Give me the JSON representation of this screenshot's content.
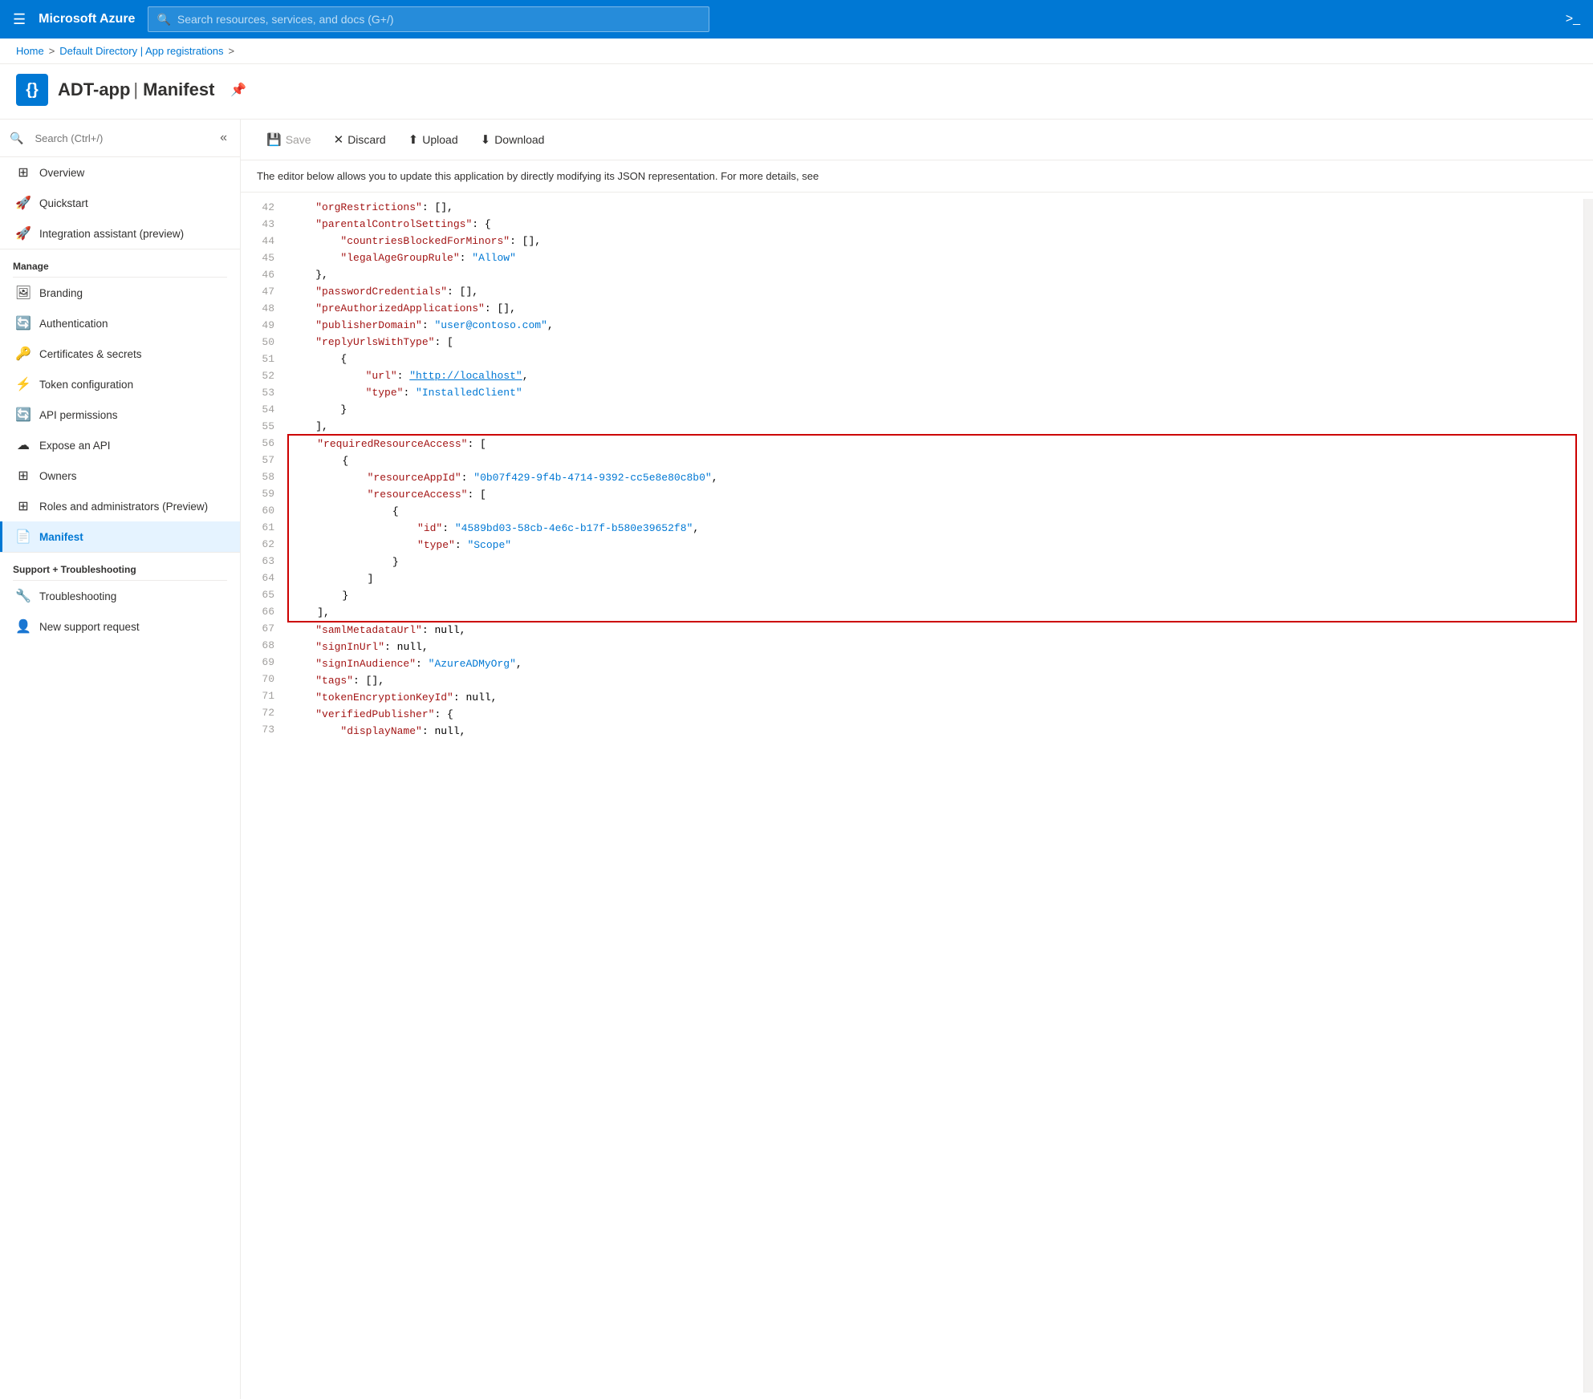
{
  "topNav": {
    "brand": "Microsoft Azure",
    "searchPlaceholder": "Search resources, services, and docs (G+/)",
    "hamburgerIcon": "☰",
    "cloudShellIcon": ">_"
  },
  "breadcrumb": {
    "home": "Home",
    "separator1": ">",
    "directoryLink": "Default Directory | App registrations",
    "separator2": ">"
  },
  "pageHeader": {
    "iconSymbol": "{}",
    "appName": "ADT-app",
    "separator": "|",
    "pageName": "Manifest",
    "pinIcon": "📌"
  },
  "toolbar": {
    "saveLabel": "Save",
    "discardLabel": "Discard",
    "uploadLabel": "Upload",
    "downloadLabel": "Download"
  },
  "description": "The editor below allows you to update this application by directly modifying its JSON representation. For more details, see",
  "sidebar": {
    "searchPlaceholder": "Search (Ctrl+/)",
    "items": [
      {
        "id": "overview",
        "label": "Overview",
        "icon": "⊞",
        "active": false
      },
      {
        "id": "quickstart",
        "label": "Quickstart",
        "icon": "🚀",
        "active": false
      },
      {
        "id": "integration",
        "label": "Integration assistant (preview)",
        "icon": "🚀",
        "active": false
      }
    ],
    "manageSection": "Manage",
    "manageItems": [
      {
        "id": "branding",
        "label": "Branding",
        "icon": "🖼",
        "active": false
      },
      {
        "id": "authentication",
        "label": "Authentication",
        "icon": "🔄",
        "active": false
      },
      {
        "id": "certificates",
        "label": "Certificates & secrets",
        "icon": "🔑",
        "active": false
      },
      {
        "id": "token",
        "label": "Token configuration",
        "icon": "⚡",
        "active": false
      },
      {
        "id": "api-permissions",
        "label": "API permissions",
        "icon": "🔄",
        "active": false
      },
      {
        "id": "expose-api",
        "label": "Expose an API",
        "icon": "☁",
        "active": false
      },
      {
        "id": "owners",
        "label": "Owners",
        "icon": "⊞",
        "active": false
      },
      {
        "id": "roles",
        "label": "Roles and administrators (Preview)",
        "icon": "⊞",
        "active": false
      },
      {
        "id": "manifest",
        "label": "Manifest",
        "icon": "📄",
        "active": true
      }
    ],
    "supportSection": "Support + Troubleshooting",
    "supportItems": [
      {
        "id": "troubleshooting",
        "label": "Troubleshooting",
        "icon": "🔧",
        "active": false
      },
      {
        "id": "support",
        "label": "New support request",
        "icon": "👤",
        "active": false
      }
    ]
  },
  "codeLines": [
    {
      "num": 42,
      "content": "    \"orgRestrictions\": [],",
      "highlight": false
    },
    {
      "num": 43,
      "content": "    \"parentalControlSettings\": {",
      "highlight": false
    },
    {
      "num": 44,
      "content": "        \"countriesBlockedForMinors\": [],",
      "highlight": false
    },
    {
      "num": 45,
      "content": "        \"legalAgeGroupRule\": \"Allow\"",
      "highlight": false
    },
    {
      "num": 46,
      "content": "    },",
      "highlight": false
    },
    {
      "num": 47,
      "content": "    \"passwordCredentials\": [],",
      "highlight": false
    },
    {
      "num": 48,
      "content": "    \"preAuthorizedApplications\": [],",
      "highlight": false
    },
    {
      "num": 49,
      "content": "    \"publisherDomain\": \"user@contoso.com\",",
      "highlight": false
    },
    {
      "num": 50,
      "content": "    \"replyUrlsWithType\": [",
      "highlight": false
    },
    {
      "num": 51,
      "content": "        {",
      "highlight": false
    },
    {
      "num": 52,
      "content": "            \"url\": \"http://localhost\",",
      "highlight": false,
      "hasLink": true,
      "linkText": "http://localhost"
    },
    {
      "num": 53,
      "content": "            \"type\": \"InstalledClient\"",
      "highlight": false
    },
    {
      "num": 54,
      "content": "        }",
      "highlight": false
    },
    {
      "num": 55,
      "content": "    ],",
      "highlight": false
    },
    {
      "num": 56,
      "content": "    \"requiredResourceAccess\": [",
      "highlight": true
    },
    {
      "num": 57,
      "content": "        {",
      "highlight": true
    },
    {
      "num": 58,
      "content": "            \"resourceAppId\": \"0b07f429-9f4b-4714-9392-cc5e8e80c8b0\",",
      "highlight": true
    },
    {
      "num": 59,
      "content": "            \"resourceAccess\": [",
      "highlight": true
    },
    {
      "num": 60,
      "content": "                {",
      "highlight": true
    },
    {
      "num": 61,
      "content": "                    \"id\": \"4589bd03-58cb-4e6c-b17f-b580e39652f8\",",
      "highlight": true
    },
    {
      "num": 62,
      "content": "                    \"type\": \"Scope\"",
      "highlight": true
    },
    {
      "num": 63,
      "content": "                }",
      "highlight": true
    },
    {
      "num": 64,
      "content": "            ]",
      "highlight": true
    },
    {
      "num": 65,
      "content": "        }",
      "highlight": true
    },
    {
      "num": 66,
      "content": "    ],",
      "highlight": true
    },
    {
      "num": 67,
      "content": "    \"samlMetadataUrl\": null,",
      "highlight": false
    },
    {
      "num": 68,
      "content": "    \"signInUrl\": null,",
      "highlight": false
    },
    {
      "num": 69,
      "content": "    \"signInAudience\": \"AzureADMyOrg\",",
      "highlight": false
    },
    {
      "num": 70,
      "content": "    \"tags\": [],",
      "highlight": false
    },
    {
      "num": 71,
      "content": "    \"tokenEncryptionKeyId\": null,",
      "highlight": false
    },
    {
      "num": 72,
      "content": "    \"verifiedPublisher\": {",
      "highlight": false
    },
    {
      "num": 73,
      "content": "        \"displayName\": null,",
      "highlight": false
    }
  ]
}
